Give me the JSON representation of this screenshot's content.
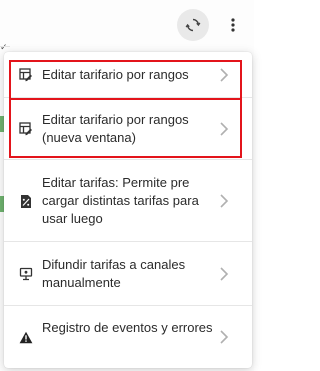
{
  "toolbar": {
    "refresh_icon": "sync-icon",
    "more_icon": "more-vertical-icon"
  },
  "menu": {
    "items": [
      {
        "label": "Editar tarifario por rangos",
        "icon": "table-edit-icon"
      },
      {
        "label": "Editar tarifario por rangos (nueva ventana)",
        "icon": "table-edit-icon"
      },
      {
        "label": "Editar tarifas: Permite pre cargar distintas tarifas para usar luego",
        "icon": "percent-doc-icon"
      },
      {
        "label": "Difundir tarifas a canales manualmente",
        "icon": "broadcast-monitor-icon"
      },
      {
        "label": "Registro de eventos y errores",
        "icon": "warning-icon"
      }
    ],
    "chevron_icon": "chevron-right-icon"
  },
  "colors": {
    "highlight": "#e3141b",
    "accent_green": "#6fb36f",
    "text": "#2b2b2b"
  }
}
